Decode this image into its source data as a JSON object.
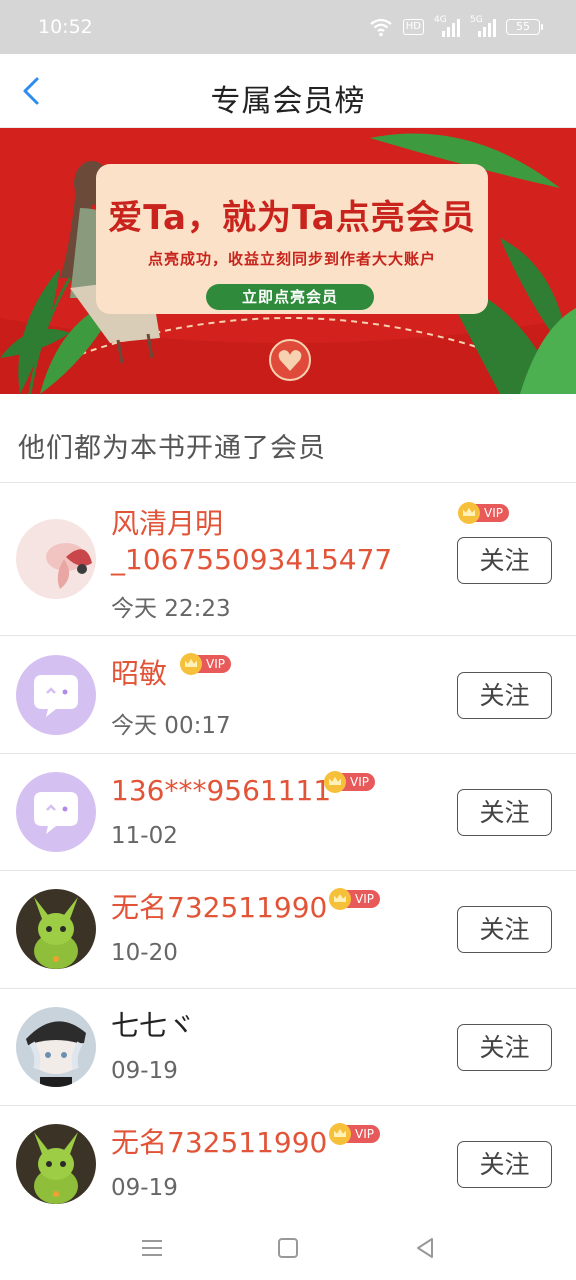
{
  "status_bar": {
    "time": "10:52",
    "hd_label": "HD",
    "network_1": "4G",
    "network_2": "5G",
    "battery": "55"
  },
  "header": {
    "back_icon": "chevron-left-icon",
    "title": "专属会员榜"
  },
  "banner": {
    "headline": "爱Ta，就为Ta点亮会员",
    "subtitle": "点亮成功，收益立刻同步到作者大大账户",
    "cta_label": "立即点亮会员",
    "background_color": "#d3221e",
    "card_color": "#fbe1c7"
  },
  "section_title": "他们都为本书开通了会员",
  "members": [
    {
      "name": "风清月明_106755093415477",
      "time": "今天 22:23",
      "vip_label": "VIP",
      "follow_label": "关注",
      "avatar": "flower-avatar",
      "name_color": "#e25438"
    },
    {
      "name": "昭敏",
      "time": "今天 00:17",
      "vip_label": "VIP",
      "follow_label": "关注",
      "avatar": "default-chat-avatar",
      "name_color": "#e25438"
    },
    {
      "name": "136***9561111",
      "time": "11-02",
      "vip_label": "VIP",
      "follow_label": "关注",
      "avatar": "default-chat-avatar",
      "name_color": "#e25438"
    },
    {
      "name": "无名732511990",
      "time": "10-20",
      "vip_label": "VIP",
      "follow_label": "关注",
      "avatar": "creature-avatar",
      "name_color": "#e25438"
    },
    {
      "name": "七七ヾ",
      "time": "09-19",
      "vip_label": "",
      "follow_label": "关注",
      "avatar": "anime-boy-avatar",
      "name_color": "#222222"
    },
    {
      "name": "无名732511990",
      "time": "09-19",
      "vip_label": "VIP",
      "follow_label": "关注",
      "avatar": "creature-avatar",
      "name_color": "#e25438"
    }
  ],
  "system_nav": {
    "menu_icon": "menu-icon",
    "home_icon": "home-square-icon",
    "back_icon": "back-triangle-icon"
  },
  "colors": {
    "accent_red": "#e25438",
    "vip_gold": "#f7c03a",
    "vip_tag": "#e85a5a",
    "header_blue": "#2d8cf0"
  }
}
